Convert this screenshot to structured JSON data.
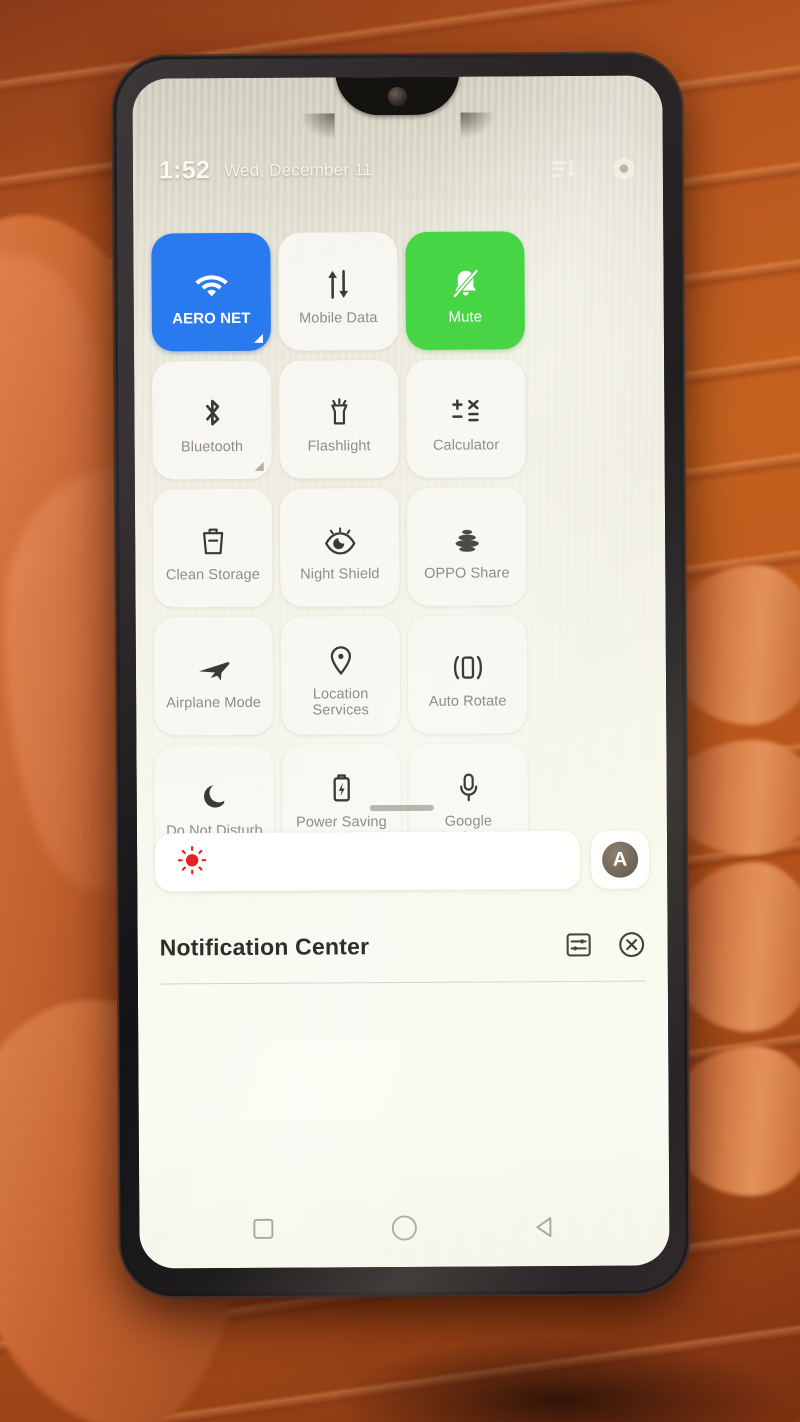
{
  "device": {
    "frame_color": "#1c1b1d",
    "screen_tint": "#f2f1e9"
  },
  "status_bar": {
    "time": "1:52",
    "date": "Wed, December 11",
    "icons": [
      {
        "name": "sort-filter-icon",
        "glyph": "sort"
      },
      {
        "name": "settings-gear-icon",
        "glyph": "gear"
      }
    ],
    "data_usage": "\"SIM1\" Data Usage. Today: 0 B, This Month: 290 MB"
  },
  "quick_settings": {
    "accent_on_blue": "#2979ef",
    "accent_on_green": "#47d546",
    "tile_bg": "#f8f7f2",
    "tiles": [
      {
        "label": "AERO NET",
        "icon": "wifi-icon",
        "state": "on-blue",
        "expander": true,
        "expander_light": true
      },
      {
        "label": "Mobile Data",
        "icon": "mobile-data-icon",
        "state": "off",
        "expander": false
      },
      {
        "label": "Mute",
        "icon": "bell-mute-icon",
        "state": "on-green",
        "expander": false
      },
      {
        "label": "Bluetooth",
        "icon": "bluetooth-icon",
        "state": "off",
        "expander": true,
        "expander_light": false
      },
      {
        "label": "Flashlight",
        "icon": "flashlight-icon",
        "state": "off",
        "expander": false
      },
      {
        "label": "Calculator",
        "icon": "calculator-icon",
        "state": "off",
        "expander": false
      },
      {
        "label": "Clean Storage",
        "icon": "trash-clean-icon",
        "state": "off",
        "expander": false
      },
      {
        "label": "Night Shield",
        "icon": "eye-moon-icon",
        "state": "off",
        "expander": false
      },
      {
        "label": "OPPO Share",
        "icon": "oppo-share-icon",
        "state": "off",
        "expander": false
      },
      {
        "label": "Airplane Mode",
        "icon": "airplane-icon",
        "state": "off",
        "expander": false
      },
      {
        "label": "Location Services",
        "icon": "location-pin-icon",
        "state": "off",
        "expander": false
      },
      {
        "label": "Auto Rotate",
        "icon": "auto-rotate-icon",
        "state": "off",
        "expander": false
      },
      {
        "label": "Do Not Disturb",
        "icon": "moon-icon",
        "state": "off",
        "expander": false
      },
      {
        "label": "Power Saving Mode",
        "icon": "battery-saver-icon",
        "state": "off",
        "expander": false
      },
      {
        "label": "Google Assistant",
        "icon": "microphone-icon",
        "state": "off",
        "expander": false
      }
    ]
  },
  "brightness": {
    "slider_icon": "brightness-sun-icon",
    "sun_color": "#e8211d",
    "level_percent": 0,
    "auto_label": "A",
    "auto_icon": "auto-brightness-icon"
  },
  "notification_center": {
    "title": "Notification Center",
    "manage_icon": "manage-notifications-icon",
    "clear_icon": "clear-all-icon",
    "notifications": []
  },
  "nav_bar": {
    "buttons": [
      {
        "name": "recents-button",
        "icon": "square-icon"
      },
      {
        "name": "home-button",
        "icon": "circle-icon"
      },
      {
        "name": "back-button",
        "icon": "triangle-left-icon"
      }
    ]
  }
}
